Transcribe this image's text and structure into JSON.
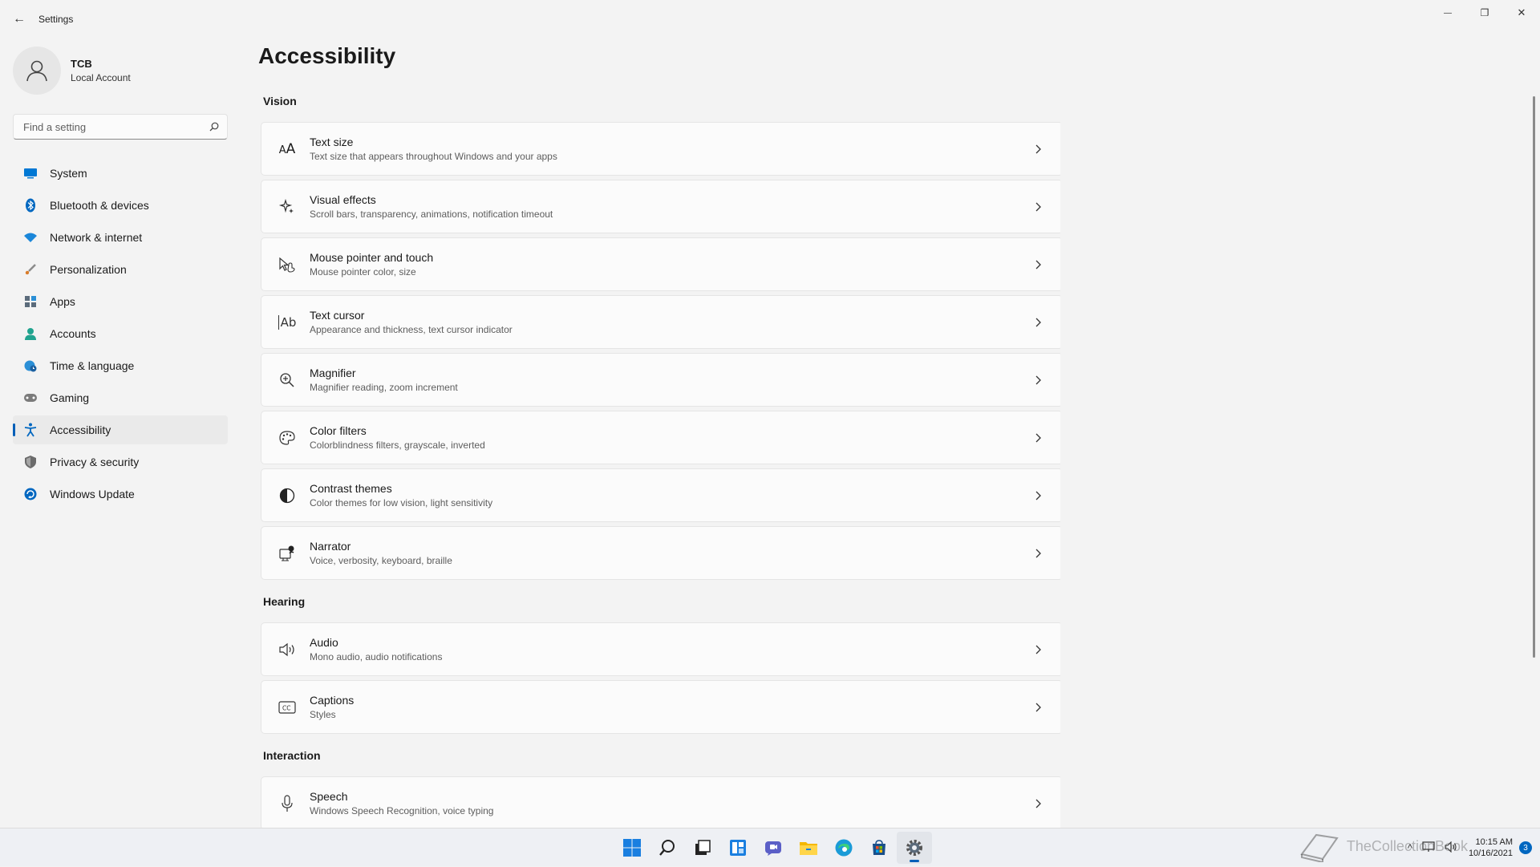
{
  "window": {
    "back_glyph": "←",
    "app_title": "Settings",
    "minimize_glyph": "—",
    "restore_glyph": "❐",
    "close_glyph": "✕"
  },
  "profile": {
    "name": "TCB",
    "account_type": "Local Account"
  },
  "search": {
    "placeholder": "Find a setting"
  },
  "sidebar": {
    "items": [
      {
        "label": "System",
        "icon": "monitor-icon",
        "color": "#0078d4"
      },
      {
        "label": "Bluetooth & devices",
        "icon": "bluetooth-icon",
        "color": "#0067c0"
      },
      {
        "label": "Network & internet",
        "icon": "wifi-icon",
        "color": "#1a86d9"
      },
      {
        "label": "Personalization",
        "icon": "brush-icon",
        "color": "#d97d2b"
      },
      {
        "label": "Apps",
        "icon": "apps-icon",
        "color": "#5b6b7b"
      },
      {
        "label": "Accounts",
        "icon": "person-icon",
        "color": "#20a38f"
      },
      {
        "label": "Time & language",
        "icon": "globe-clock-icon",
        "color": "#2b8fd6"
      },
      {
        "label": "Gaming",
        "icon": "controller-icon",
        "color": "#7a7a7a"
      },
      {
        "label": "Accessibility",
        "icon": "accessibility-icon",
        "color": "#0067c0",
        "active": true
      },
      {
        "label": "Privacy & security",
        "icon": "shield-icon",
        "color": "#6b6b6b"
      },
      {
        "label": "Windows Update",
        "icon": "update-icon",
        "color": "#0067c0"
      }
    ]
  },
  "main": {
    "title": "Accessibility",
    "sections": {
      "vision": "Vision",
      "hearing": "Hearing",
      "interaction": "Interaction"
    },
    "cards": [
      {
        "title": "Text size",
        "subtitle": "Text size that appears throughout Windows and your apps",
        "icon": "text-size-icon"
      },
      {
        "title": "Visual effects",
        "subtitle": "Scroll bars, transparency, animations, notification timeout",
        "icon": "sparkle-icon"
      },
      {
        "title": "Mouse pointer and touch",
        "subtitle": "Mouse pointer color, size",
        "icon": "pointer-icon"
      },
      {
        "title": "Text cursor",
        "subtitle": "Appearance and thickness, text cursor indicator",
        "icon": "text-cursor-icon"
      },
      {
        "title": "Magnifier",
        "subtitle": "Magnifier reading, zoom increment",
        "icon": "magnifier-icon"
      },
      {
        "title": "Color filters",
        "subtitle": "Colorblindness filters, grayscale, inverted",
        "icon": "palette-icon"
      },
      {
        "title": "Contrast themes",
        "subtitle": "Color themes for low vision, light sensitivity",
        "icon": "contrast-icon"
      },
      {
        "title": "Narrator",
        "subtitle": "Voice, verbosity, keyboard, braille",
        "icon": "narrator-icon"
      },
      {
        "title": "Audio",
        "subtitle": "Mono audio, audio notifications",
        "icon": "speaker-icon"
      },
      {
        "title": "Captions",
        "subtitle": "Styles",
        "icon": "captions-icon"
      },
      {
        "title": "Speech",
        "subtitle": "Windows Speech Recognition, voice typing",
        "icon": "microphone-icon"
      }
    ]
  },
  "taskbar": {
    "apps": [
      "start-icon",
      "search-icon",
      "task-view-icon",
      "widgets-icon",
      "chat-icon",
      "file-explorer-icon",
      "edge-icon",
      "store-icon",
      "settings-icon"
    ],
    "tray_up_glyph": "^",
    "time": "10:15 AM",
    "date": "10/16/2021",
    "notification_count": "3",
    "watermark": "TheCollectionBook"
  },
  "colors": {
    "accent": "#005fb8",
    "background": "#f3f3f3",
    "card": "#fbfbfb"
  }
}
